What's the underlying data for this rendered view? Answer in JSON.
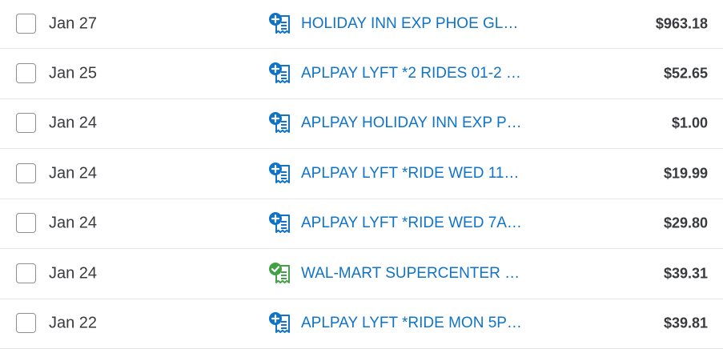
{
  "colors": {
    "link": "#0f73c7",
    "text": "#393a3d",
    "add_icon": "#0f73c7",
    "matched_icon": "#43a047",
    "divider": "#e6e6e6"
  },
  "transactions": [
    {
      "date": "Jan 27",
      "description": "HOLIDAY INN EXP PHOE GL…",
      "amount": "$963.18",
      "icon": "receipt-add-icon",
      "checked": false
    },
    {
      "date": "Jan 25",
      "description": "APLPAY LYFT *2 RIDES 01-2 …",
      "amount": "$52.65",
      "icon": "receipt-add-icon",
      "checked": false
    },
    {
      "date": "Jan 24",
      "description": "APLPAY HOLIDAY INN EXP P…",
      "amount": "$1.00",
      "icon": "receipt-add-icon",
      "checked": false
    },
    {
      "date": "Jan 24",
      "description": "APLPAY LYFT *RIDE WED 11…",
      "amount": "$19.99",
      "icon": "receipt-add-icon",
      "checked": false
    },
    {
      "date": "Jan 24",
      "description": "APLPAY LYFT *RIDE WED 7A…",
      "amount": "$29.80",
      "icon": "receipt-add-icon",
      "checked": false
    },
    {
      "date": "Jan 24",
      "description": "WAL-MART SUPERCENTER …",
      "amount": "$39.31",
      "icon": "receipt-matched-icon",
      "checked": false
    },
    {
      "date": "Jan 22",
      "description": "APLPAY LYFT *RIDE MON 5P…",
      "amount": "$39.81",
      "icon": "receipt-add-icon",
      "checked": false
    }
  ]
}
